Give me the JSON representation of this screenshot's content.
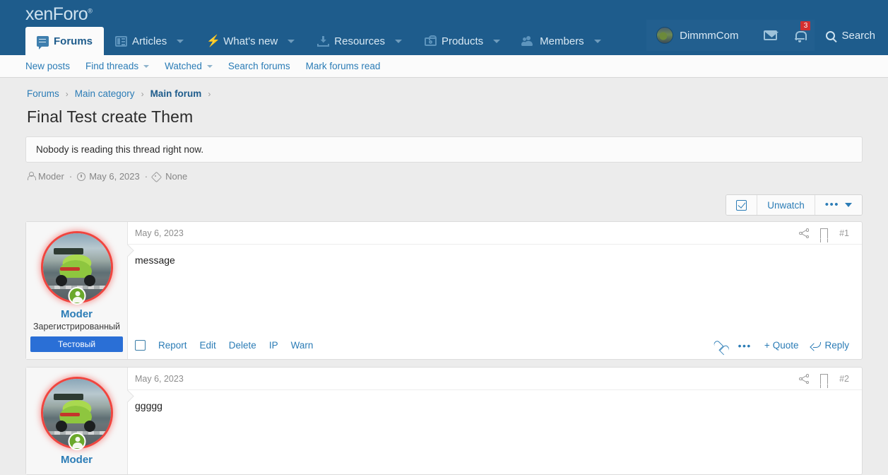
{
  "site": {
    "logo_text": "xenForo",
    "logo_mark": "®"
  },
  "nav": {
    "tabs": [
      {
        "label": "Forums",
        "icon": "speech-bubble-icon",
        "active": true,
        "has_caret": false
      },
      {
        "label": "Articles",
        "icon": "article-list-icon",
        "active": false,
        "has_caret": true
      },
      {
        "label": "What's new",
        "icon": "lightning-bolt-icon",
        "active": false,
        "has_caret": true
      },
      {
        "label": "Resources",
        "icon": "download-box-icon",
        "active": false,
        "has_caret": true
      },
      {
        "label": "Products",
        "icon": "shopping-bag-icon",
        "active": false,
        "has_caret": true
      },
      {
        "label": "Members",
        "icon": "people-icon",
        "active": false,
        "has_caret": true
      }
    ]
  },
  "user": {
    "name": "DimmmCom",
    "avatar_icon": "user-avatar",
    "inbox_icon": "envelope-icon",
    "alerts_icon": "bell-icon",
    "alerts_count": "3",
    "search_label": "Search",
    "search_icon": "magnifier-icon"
  },
  "subnav": {
    "items": [
      {
        "label": "New posts",
        "has_caret": false
      },
      {
        "label": "Find threads",
        "has_caret": true
      },
      {
        "label": "Watched",
        "has_caret": true
      },
      {
        "label": "Search forums",
        "has_caret": false
      },
      {
        "label": "Mark forums read",
        "has_caret": false
      }
    ]
  },
  "breadcrumb": [
    {
      "label": "Forums",
      "current": false
    },
    {
      "label": "Main category",
      "current": false
    },
    {
      "label": "Main forum",
      "current": true
    }
  ],
  "thread": {
    "title": "Final Test create Them",
    "notice": "Nobody is reading this thread right now.",
    "meta": {
      "author": "Moder",
      "date": "May 6, 2023",
      "tags": "None",
      "author_icon": "person-icon",
      "date_icon": "clock-icon",
      "tags_icon": "tag-icon"
    },
    "actions": {
      "watch_toggle_icon": "checkbox-checked-icon",
      "unwatch_label": "Unwatch",
      "more_label": "•••",
      "more_icon": "chevron-down-icon"
    }
  },
  "posts": [
    {
      "author": {
        "name": "Moder",
        "title": "Зарегистрированный",
        "banner": "Тестовый",
        "avatar_icon": "green-sports-car-avatar",
        "status_icon": "online-status-icon"
      },
      "date": "May 6, 2023",
      "number": "#1",
      "share_icon": "share-icon",
      "bookmark_icon": "bookmark-icon",
      "message": "message",
      "footer_left": [
        "Report",
        "Edit",
        "Delete",
        "IP",
        "Warn"
      ],
      "footer_right": {
        "like_icon": "heart-icon",
        "more_label": "•••",
        "quote_label": "Quote",
        "quote_prefix": "+",
        "reply_label": "Reply",
        "reply_icon": "reply-arrow-icon"
      }
    },
    {
      "author": {
        "name": "Moder",
        "title": "",
        "banner": "",
        "avatar_icon": "green-sports-car-avatar",
        "status_icon": "online-status-icon"
      },
      "date": "May 6, 2023",
      "number": "#2",
      "share_icon": "share-icon",
      "bookmark_icon": "bookmark-icon",
      "message": "ggggg",
      "footer_left": [],
      "footer_right": {}
    }
  ],
  "colors": {
    "header_blue": "#1e5c8c",
    "link_blue": "#2b7cb6",
    "banner_blue": "#2a6fd6",
    "badge_red": "#d32f2f",
    "page_bg": "#ececec",
    "avatar_ring": "#f0453f"
  }
}
